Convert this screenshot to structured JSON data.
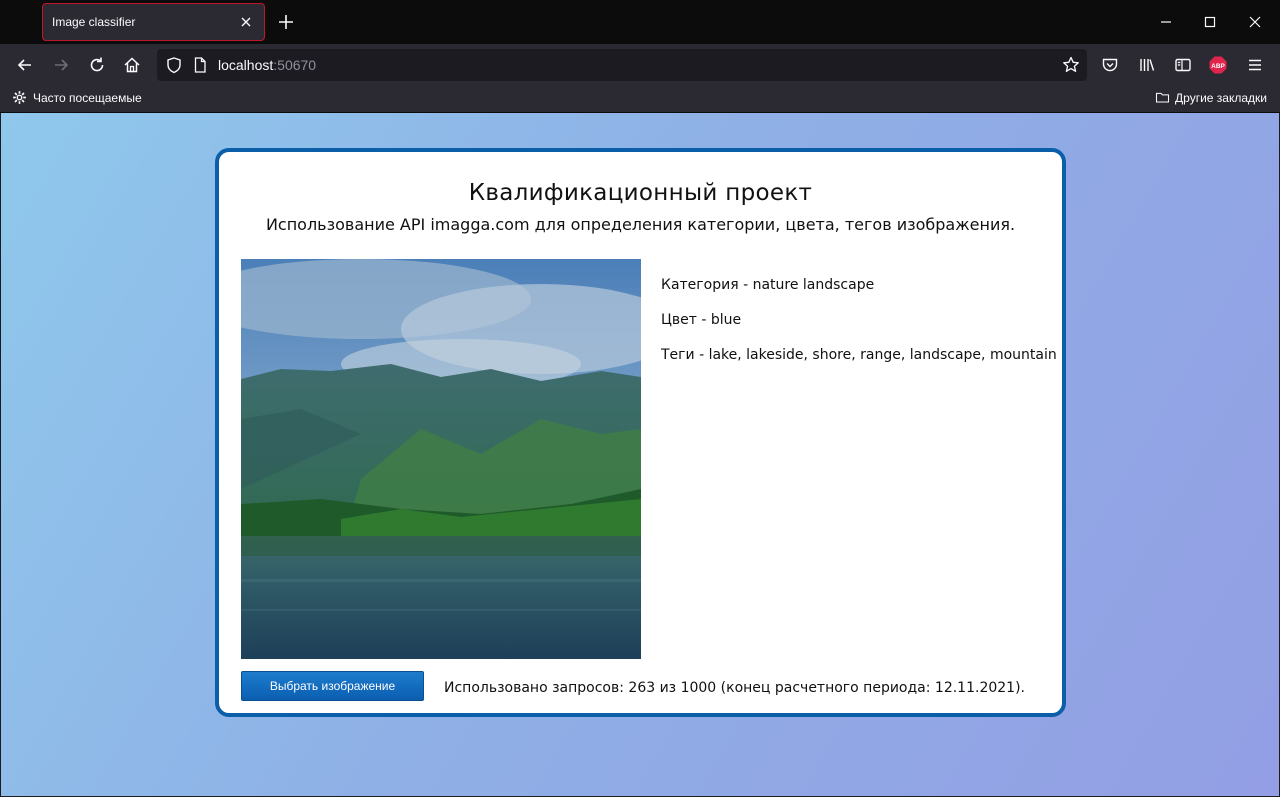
{
  "browser": {
    "tab_title": "Image classifier",
    "url_host": "localhost",
    "url_port": ":50670",
    "bookmark_left": "Часто посещаемые",
    "bookmark_right": "Другие закладки",
    "abp_label": "ABP"
  },
  "page": {
    "title": "Квалификационный проект",
    "subtitle": "Использование API imagga.com для определения категории, цвета, тегов изображения.",
    "results": {
      "category": "Категория - nature landscape",
      "color": "Цвет - blue",
      "tags": "Теги - lake, lakeside, shore, range, landscape, mountain"
    },
    "choose_button": "Выбрать изображение",
    "usage_text": "Использовано запросов: 263 из 1000 (конец расчетного периода: 12.11.2021)."
  },
  "colors": {
    "card_border": "#0b5ea8",
    "tab_border": "#c0162d",
    "button": "#1d7ccd"
  }
}
